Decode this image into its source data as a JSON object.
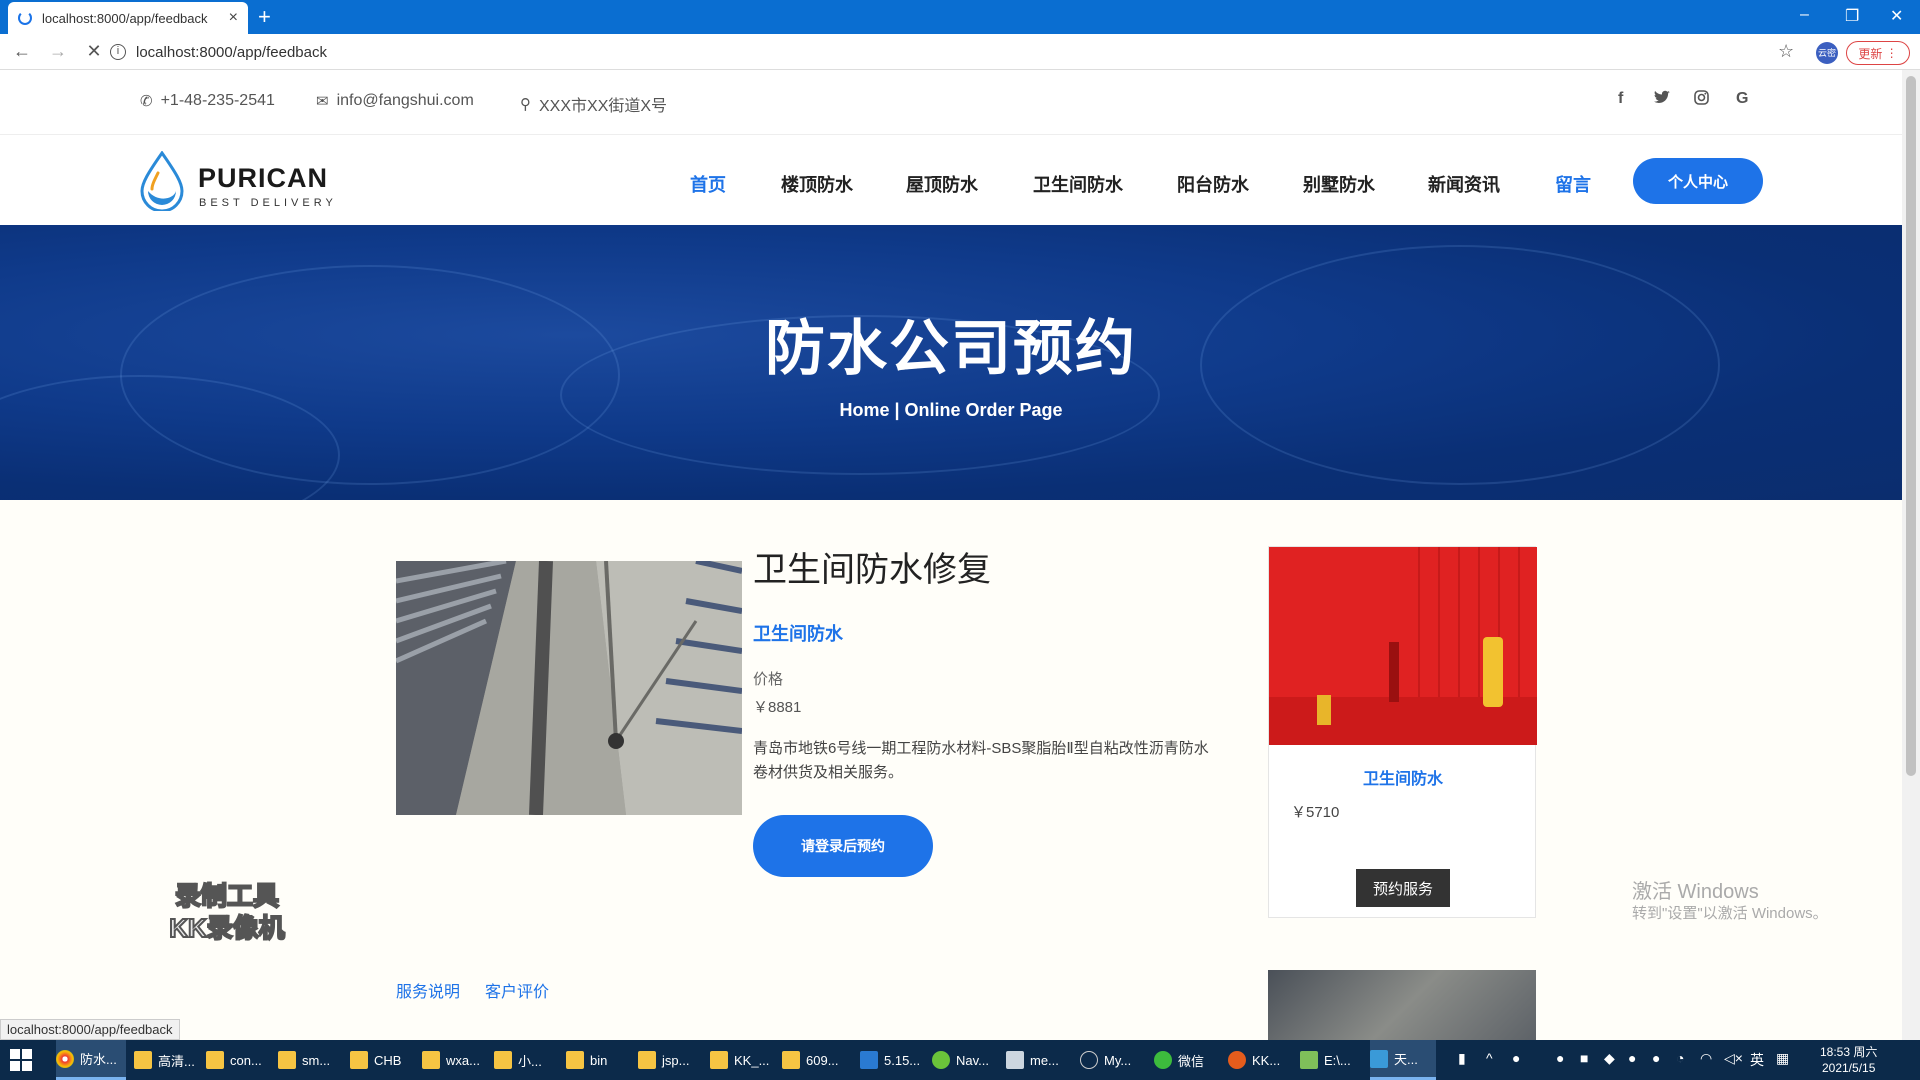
{
  "browser": {
    "tab_title": "localhost:8000/app/feedback",
    "tab_close": "×",
    "new_tab": "+",
    "url": "localhost:8000/app/feedback",
    "update_label": "更新",
    "ext_label": "云密",
    "status_url": "localhost:8000/app/feedback",
    "window_controls": [
      "–",
      "❐",
      "✕"
    ]
  },
  "topbar": {
    "phone": "+1-48-235-2541",
    "email": "info@fangshui.com",
    "address": "XXX市XX街道X号",
    "social_icons": [
      "facebook-icon",
      "twitter-icon",
      "instagram-icon",
      "google-icon"
    ]
  },
  "navbar": {
    "brand": "PURICAN",
    "brand_sub": "BEST DELIVERY",
    "menu": [
      "首页",
      "楼顶防水",
      "屋顶防水",
      "卫生间防水",
      "阳台防水",
      "别墅防水",
      "新闻资讯",
      "留言"
    ],
    "user_center": "个人中心",
    "accent": "#1e73e8"
  },
  "hero": {
    "title": "防水公司预约",
    "breadcrumb": "Home | Online Order Page"
  },
  "product": {
    "title": "卫生间防水修复",
    "category": "卫生间防水",
    "price_label": "价格",
    "price": "￥8881",
    "description": "青岛市地铁6号线一期工程防水材料-SBS聚脂胎Ⅱ型自粘改性沥青防水卷材供货及相关服务。",
    "login_button": "请登录后预约",
    "tabs": [
      "服务说明",
      "客户评价"
    ]
  },
  "sidebar_card": {
    "category": "卫生间防水",
    "price": "￥5710",
    "book_button": "预约服务"
  },
  "overlay": {
    "watermark_line1": "录制工具",
    "watermark_line2": "KK录像机",
    "activate_title": "激活 Windows",
    "activate_sub": "转到\"设置\"以激活 Windows。"
  },
  "taskbar": {
    "items": [
      "防水...",
      "高清...",
      "con...",
      "sm...",
      "CHB",
      "wxa...",
      "小...",
      "bin",
      "jsp...",
      "KK_...",
      "609...",
      "5.15...",
      "Nav...",
      "me...",
      "My...",
      "微信",
      "KK...",
      "E:\\...",
      "天..."
    ],
    "ime": "英",
    "time": "18:53 周六",
    "date": "2021/5/15"
  }
}
